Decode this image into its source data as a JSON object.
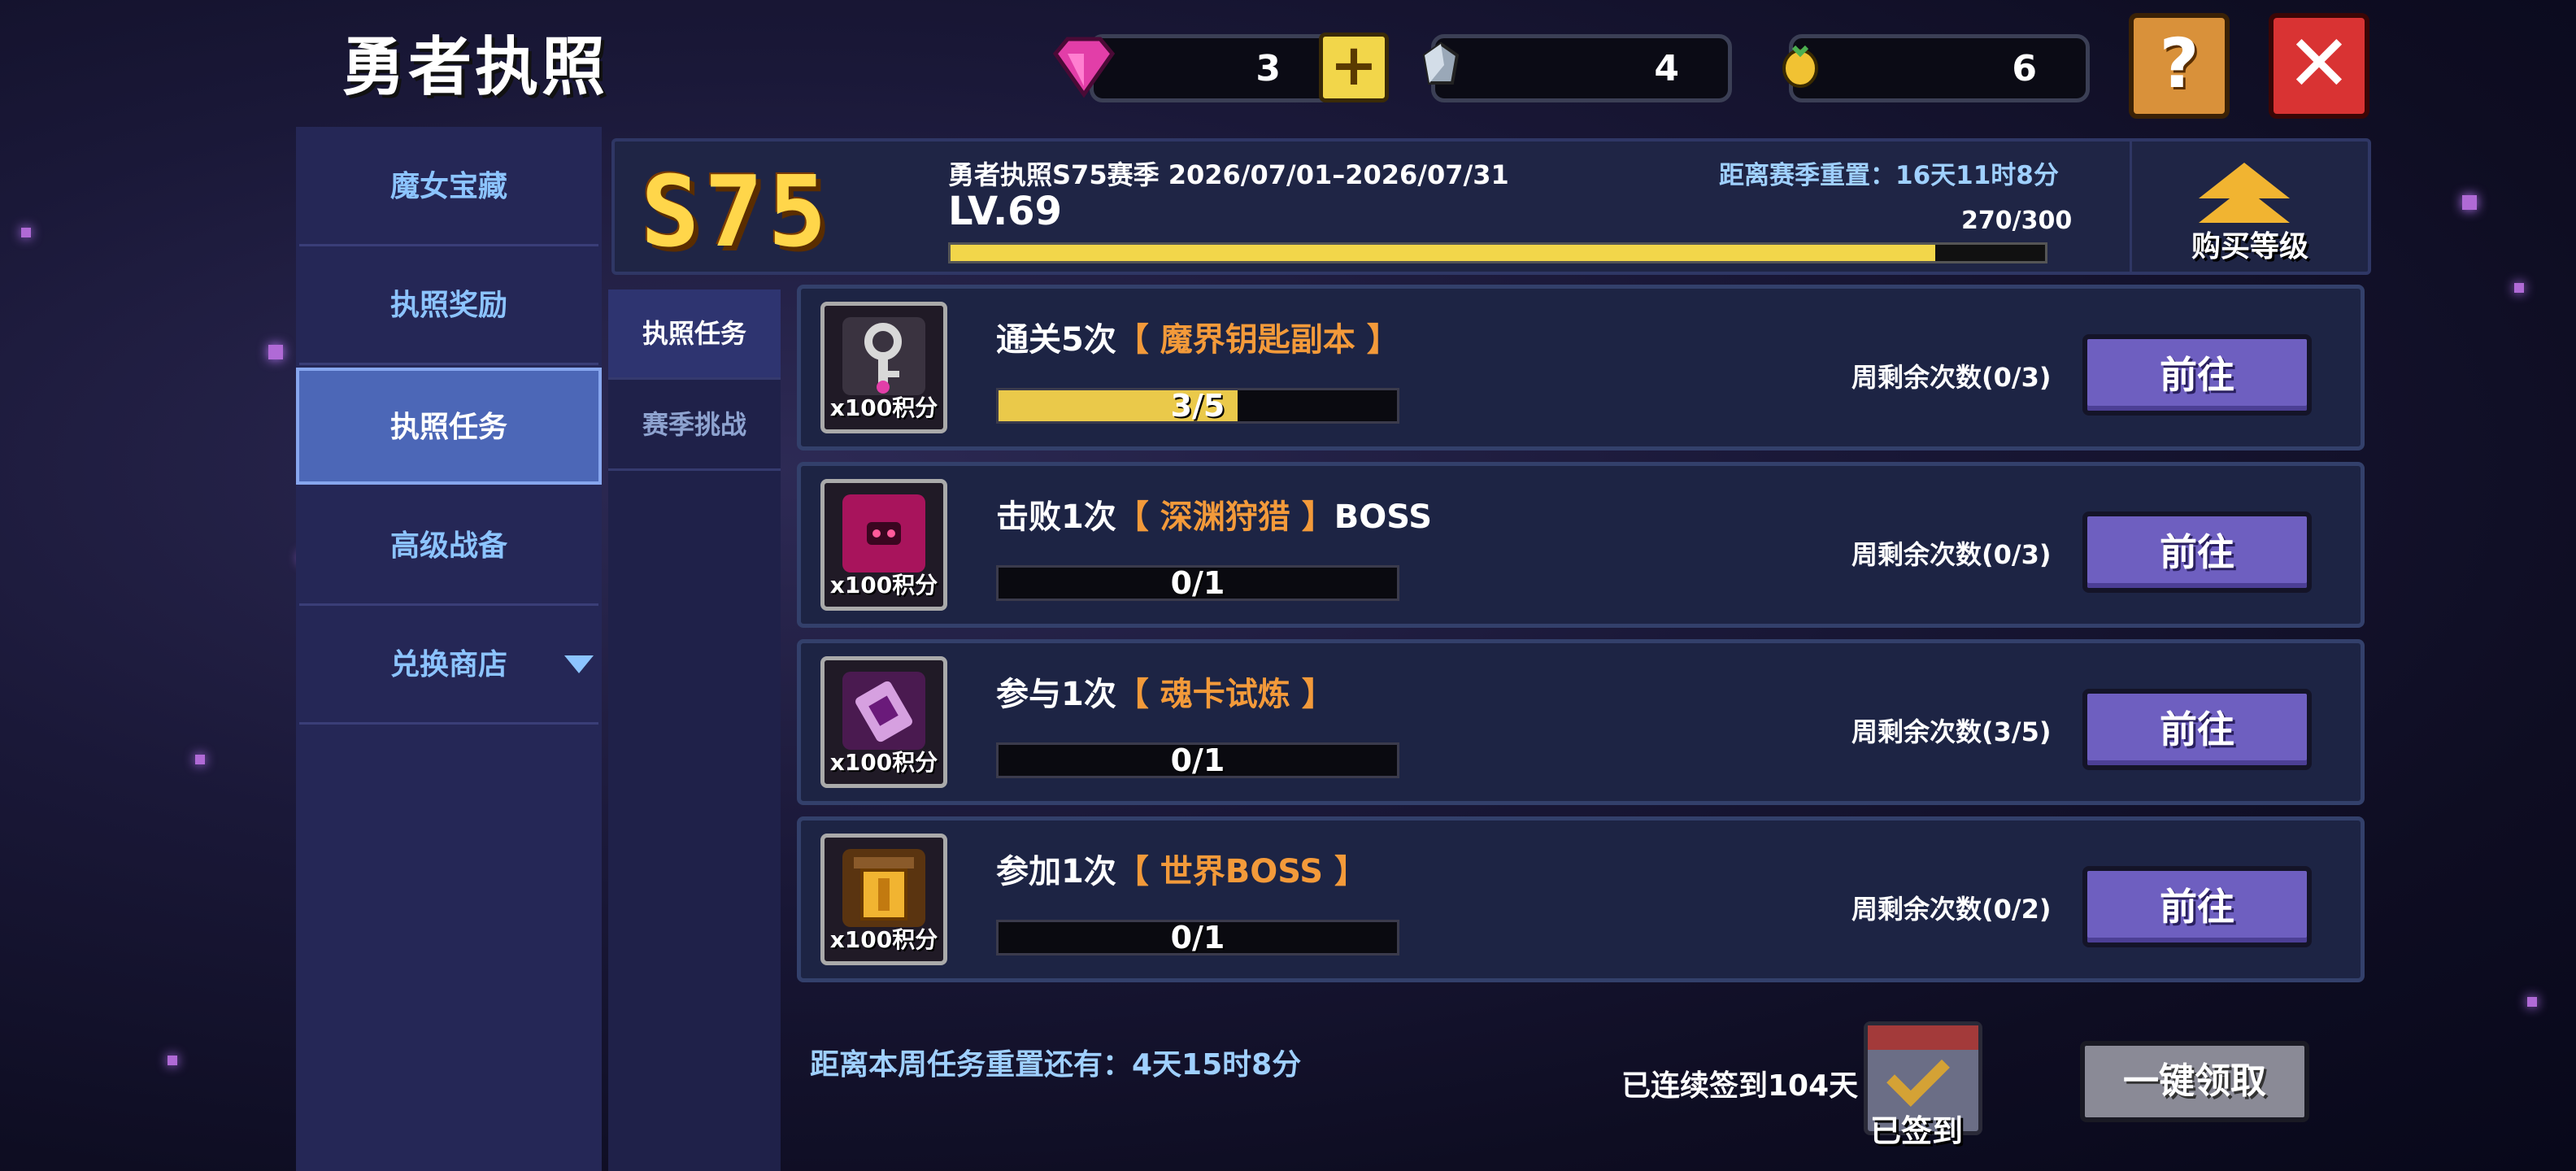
{
  "title": "勇者执照",
  "currency": {
    "gems": "3",
    "crystal": "4",
    "coin": "6"
  },
  "nav": {
    "items": [
      {
        "label": "魔女宝藏"
      },
      {
        "label": "执照奖励"
      },
      {
        "label": "执照任务"
      },
      {
        "label": "高级战备"
      },
      {
        "label": "兑换商店"
      }
    ]
  },
  "subnav": {
    "items": [
      {
        "label": "执照任务"
      },
      {
        "label": "赛季挑战"
      }
    ]
  },
  "header": {
    "season_badge": "S75",
    "season_title": "勇者执照S75赛季 2026/07/01–2026/07/31",
    "level": "LV.69",
    "reset_text": "距离赛季重置：16天11时8分",
    "exp_text": "270/300",
    "exp_progress": 0.9,
    "buy_level_label": "购买等级"
  },
  "tasks": [
    {
      "prefix": "通关5次",
      "highlight": "【 魔界钥匙副本 】",
      "suffix": "",
      "points": "x100积分",
      "progress": "3/5",
      "fill": 0.6,
      "remaining": "周剩余次数(0/3)",
      "button": "前往",
      "icon": "key-icon",
      "icon_color": "#c7c7c7"
    },
    {
      "prefix": "击败1次",
      "highlight": "【 深渊狩猎 】",
      "suffix": "BOSS",
      "points": "x100积分",
      "progress": "0/1",
      "fill": 0,
      "remaining": "周剩余次数(0/3)",
      "button": "前往",
      "icon": "abyss-icon",
      "icon_color": "#a8145c"
    },
    {
      "prefix": "参与1次",
      "highlight": "【 魂卡试炼 】",
      "suffix": "",
      "points": "x100积分",
      "progress": "0/1",
      "fill": 0,
      "remaining": "周剩余次数(3/5)",
      "button": "前往",
      "icon": "soul-card-icon",
      "icon_color": "#8a2a8f"
    },
    {
      "prefix": "参加1次",
      "highlight": "【 世界BOSS 】",
      "suffix": "",
      "points": "x100积分",
      "progress": "0/1",
      "fill": 0,
      "remaining": "周剩余次数(0/2)",
      "button": "前往",
      "icon": "world-boss-icon",
      "icon_color": "#d98a2a"
    }
  ],
  "footer": {
    "weekly_reset": "距离本周任务重置还有：4天15时8分",
    "streak": "已连续签到104天",
    "signed_label": "已签到",
    "claim_all": "一键领取"
  }
}
